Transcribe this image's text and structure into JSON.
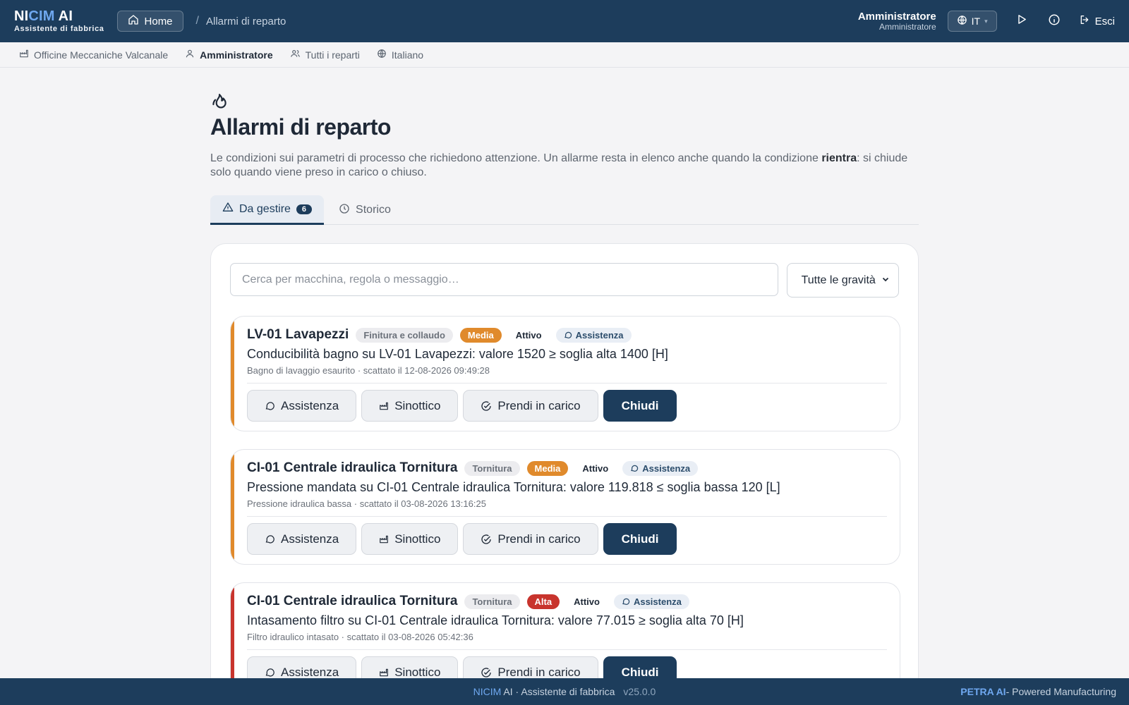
{
  "header": {
    "brand_ni": "NI",
    "brand_cim": "CIM",
    "brand_ai": " AI",
    "brand_sub": "Assistente di fabbrica",
    "home_label": "Home",
    "breadcrumb_sep": "/",
    "breadcrumb_current": "Allarmi di reparto",
    "user_name": "Amministratore",
    "user_role": "Amministratore",
    "lang_label": "IT",
    "exit_label": "Esci"
  },
  "subbar": {
    "plant": "Officine Meccaniche Valcanale",
    "user": "Amministratore",
    "departments": "Tutti i reparti",
    "language": "Italiano"
  },
  "page": {
    "title": "Allarmi di reparto",
    "desc_pre": "Le condizioni sui parametri di processo che richiedono attenzione. Un allarme resta in elenco anche quando la condizione ",
    "desc_bold": "rientra",
    "desc_post": ": si chiude solo quando viene preso in carico o chiuso."
  },
  "tabs": {
    "todo_label": "Da gestire",
    "todo_count": "6",
    "history_label": "Storico"
  },
  "filters": {
    "search_placeholder": "Cerca per macchina, regola o messaggio…",
    "severity_selected": "Tutte le gravità"
  },
  "actions": {
    "assist": "Assistenza",
    "synoptic": "Sinottico",
    "take": "Prendi in carico",
    "close": "Chiudi"
  },
  "colors": {
    "primary": "#1d3d5c",
    "media": "#e08a2c",
    "alta": "#c8342d"
  },
  "alarms": [
    {
      "machine": "LV-01 Lavapezzi",
      "department": "Finitura e collaudo",
      "severity": "Media",
      "state": "Attivo",
      "assist_tag": "Assistenza",
      "message": "Conducibilità bagno su LV-01 Lavapezzi: valore 1520 ≥ soglia alta 1400 [H]",
      "meta": "Bagno di lavaggio esaurito · scattato il 12-08-2026 09:49:28"
    },
    {
      "machine": "CI-01 Centrale idraulica Tornitura",
      "department": "Tornitura",
      "severity": "Media",
      "state": "Attivo",
      "assist_tag": "Assistenza",
      "message": "Pressione mandata su CI-01 Centrale idraulica Tornitura: valore 119.818 ≤ soglia bassa 120 [L]",
      "meta": "Pressione idraulica bassa · scattato il 03-08-2026 13:16:25"
    },
    {
      "machine": "CI-01 Centrale idraulica Tornitura",
      "department": "Tornitura",
      "severity": "Alta",
      "state": "Attivo",
      "assist_tag": "Assistenza",
      "message": "Intasamento filtro su CI-01 Centrale idraulica Tornitura: valore 77.015 ≥ soglia alta 70 [H]",
      "meta": "Filtro idraulico intasato · scattato il 03-08-2026 05:42:36"
    }
  ],
  "footer": {
    "app_brand": "NICIM",
    "app_rest": " AI · Assistente di fabbrica",
    "version": "v25.0.0",
    "right_brand": "PETRA AI",
    "right_rest": " - Powered Manufacturing"
  }
}
